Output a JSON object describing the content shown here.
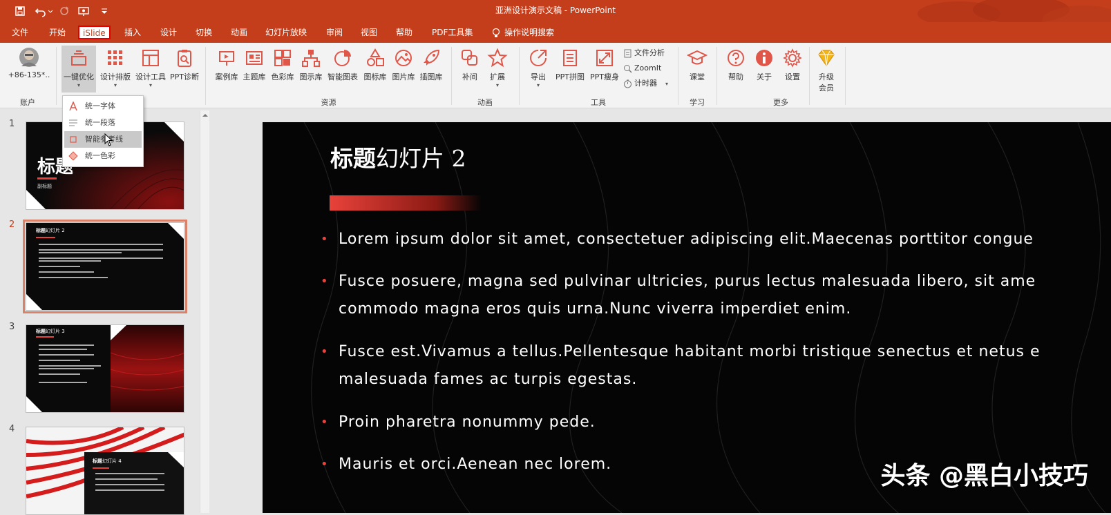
{
  "window": {
    "title": "亚洲设计演示文稿 - PowerPoint"
  },
  "quick_access": [
    {
      "name": "save-icon"
    },
    {
      "name": "undo-icon"
    },
    {
      "name": "redo-icon"
    },
    {
      "name": "present-icon"
    },
    {
      "name": "customize-icon"
    }
  ],
  "menu": {
    "items": [
      "文件",
      "开始",
      "iSlide",
      "插入",
      "设计",
      "切换",
      "动画",
      "幻灯片放映",
      "审阅",
      "视图",
      "帮助",
      "PDF工具集"
    ],
    "active": "iSlide",
    "tell_me": "操作说明搜索"
  },
  "ribbon": {
    "account": {
      "label": "+86-135*..",
      "group": "账户"
    },
    "design_group": {
      "buttons": [
        "一键优化",
        "设计排版",
        "设计工具",
        "PPT诊断"
      ]
    },
    "resource_group": {
      "buttons": [
        "案例库",
        "主题库",
        "色彩库",
        "图示库",
        "智能图表",
        "图标库",
        "图片库",
        "插图库"
      ],
      "label": "资源"
    },
    "animation_group": {
      "buttons": [
        "补间",
        "扩展"
      ],
      "label": "动画"
    },
    "tools_group": {
      "buttons": [
        "导出",
        "PPT拼图",
        "PPT瘦身"
      ],
      "small": [
        "文件分析",
        "ZoomIt",
        "计时器"
      ],
      "label": "工具"
    },
    "learn_group": {
      "buttons": [
        "课堂"
      ],
      "label": "学习"
    },
    "more_group": {
      "buttons": [
        "帮助",
        "关于",
        "设置"
      ],
      "upgrade": [
        "升级",
        "会员"
      ],
      "label": "更多"
    }
  },
  "dropdown": {
    "items": [
      "统一字体",
      "统一段落",
      "智能参考线",
      "统一色彩"
    ],
    "hovered": "智能参考线"
  },
  "slides": [
    {
      "number": "1",
      "title": "标题",
      "subtitle": "副标题"
    },
    {
      "number": "2",
      "title_bold": "标题",
      "title_light": "幻灯片 2",
      "selected": true
    },
    {
      "number": "3",
      "title_bold": "标题",
      "title_light": "幻灯片 3"
    },
    {
      "number": "4",
      "title_bold": "标题",
      "title_light": "幻灯片 4"
    }
  ],
  "current_slide": {
    "title_bold": "标题",
    "title_light": "幻灯片 2",
    "bullets": [
      "Lorem ipsum dolor sit amet, consectetuer adipiscing elit.Maecenas porttitor congue",
      "Fusce posuere, magna sed pulvinar ultricies, purus lectus malesuada libero, sit ame",
      "commodo magna eros quis urna.Nunc viverra imperdiet enim.",
      "Fusce est.Vivamus a tellus.Pellentesque habitant morbi tristique senectus et netus e",
      "malesuada fames ac turpis egestas.",
      "Proin pharetra nonummy pede.",
      "Mauris et orci.Aenean nec lorem."
    ]
  },
  "watermark": "头条 @黑白小技巧",
  "colors": {
    "brand": "#c43e1c",
    "accent": "#e8423a",
    "slide_bg": "#050505"
  }
}
